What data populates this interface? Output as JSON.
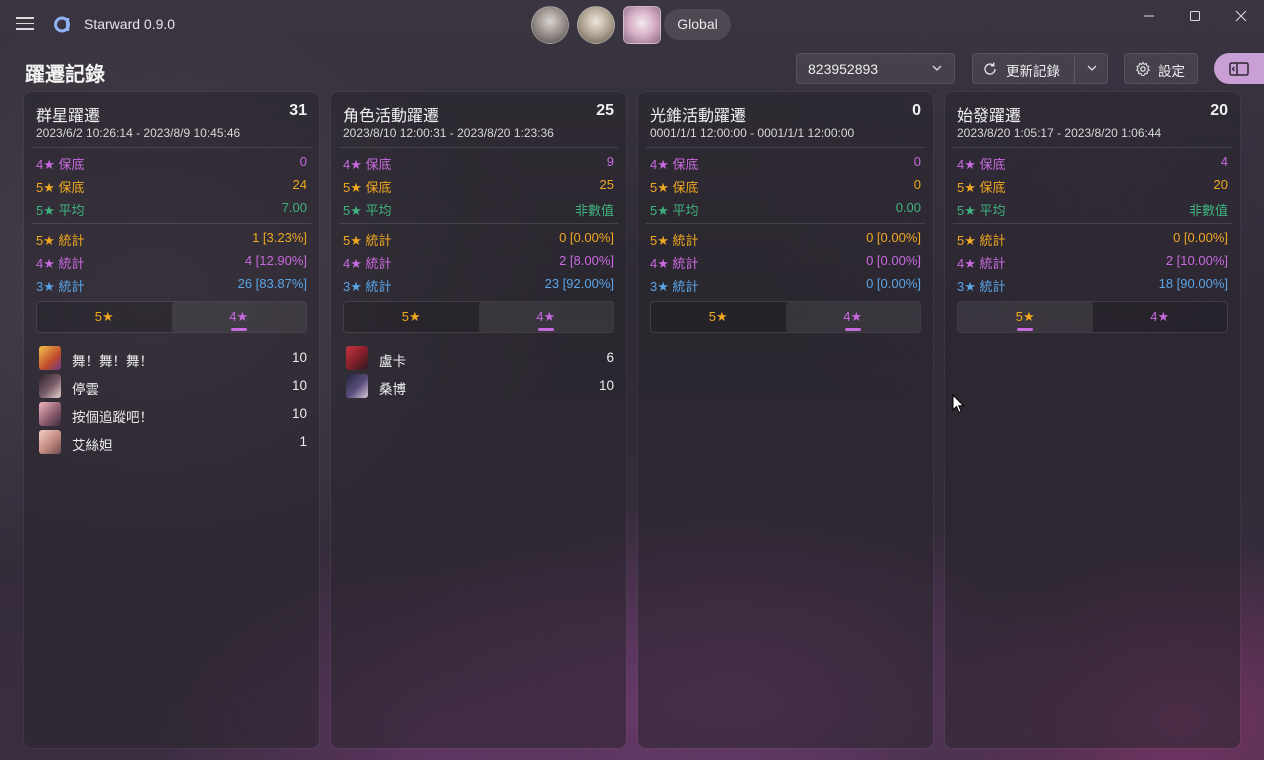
{
  "app": {
    "title": "Starward 0.9.0"
  },
  "server_button": "Global",
  "page_title": "躍遷記錄",
  "uid_select": {
    "value": "823952893"
  },
  "toolbar": {
    "refresh_label": "更新記錄",
    "settings_label": "設定"
  },
  "colors": {
    "four_star": "#c86adf",
    "five_star": "#efa821",
    "average": "#3fb37f",
    "three_star": "#5aa5e8",
    "accent": "#c9a0d6"
  },
  "cards": [
    {
      "title": "群星躍遷",
      "total": "31",
      "range": "2023/6/2 10:26:14 - 2023/8/9 10:45:46",
      "pity": [
        {
          "label": "4★ 保底",
          "value": "0"
        },
        {
          "label": "5★ 保底",
          "value": "24"
        },
        {
          "label": "5★ 平均",
          "value": "7.00"
        }
      ],
      "stats": [
        {
          "label": "5★ 統計",
          "value": "1 [3.23%]"
        },
        {
          "label": "4★ 統計",
          "value": "4 [12.90%]"
        },
        {
          "label": "3★ 統計",
          "value": "26 [83.87%]"
        }
      ],
      "tabs": [
        "5★",
        "4★"
      ],
      "selected_tab": "4★",
      "items": [
        {
          "name": "舞！舞！舞！",
          "count": "10"
        },
        {
          "name": "停雲",
          "count": "10"
        },
        {
          "name": "按個追蹤吧！",
          "count": "10"
        },
        {
          "name": "艾絲妲",
          "count": "1"
        }
      ]
    },
    {
      "title": "角色活動躍遷",
      "total": "25",
      "range": "2023/8/10 12:00:31 - 2023/8/20 1:23:36",
      "pity": [
        {
          "label": "4★ 保底",
          "value": "9"
        },
        {
          "label": "5★ 保底",
          "value": "25"
        },
        {
          "label": "5★ 平均",
          "value": "非數值"
        }
      ],
      "stats": [
        {
          "label": "5★ 統計",
          "value": "0 [0.00%]"
        },
        {
          "label": "4★ 統計",
          "value": "2 [8.00%]"
        },
        {
          "label": "3★ 統計",
          "value": "23 [92.00%]"
        }
      ],
      "tabs": [
        "5★",
        "4★"
      ],
      "selected_tab": "4★",
      "items": [
        {
          "name": "盧卡",
          "count": "6"
        },
        {
          "name": "桑博",
          "count": "10"
        }
      ]
    },
    {
      "title": "光錐活動躍遷",
      "total": "0",
      "range": "0001/1/1 12:00:00 - 0001/1/1 12:00:00",
      "pity": [
        {
          "label": "4★ 保底",
          "value": "0"
        },
        {
          "label": "5★ 保底",
          "value": "0"
        },
        {
          "label": "5★ 平均",
          "value": "0.00"
        }
      ],
      "stats": [
        {
          "label": "5★ 統計",
          "value": "0 [0.00%]"
        },
        {
          "label": "4★ 統計",
          "value": "0 [0.00%]"
        },
        {
          "label": "3★ 統計",
          "value": "0 [0.00%]"
        }
      ],
      "tabs": [
        "5★",
        "4★"
      ],
      "selected_tab": "4★",
      "items": []
    },
    {
      "title": "始發躍遷",
      "total": "20",
      "range": "2023/8/20 1:05:17 - 2023/8/20 1:06:44",
      "pity": [
        {
          "label": "4★ 保底",
          "value": "4"
        },
        {
          "label": "5★ 保底",
          "value": "20"
        },
        {
          "label": "5★ 平均",
          "value": "非數值"
        }
      ],
      "stats": [
        {
          "label": "5★ 統計",
          "value": "0 [0.00%]"
        },
        {
          "label": "4★ 統計",
          "value": "2 [10.00%]"
        },
        {
          "label": "3★ 統計",
          "value": "18 [90.00%]"
        }
      ],
      "tabs": [
        "5★",
        "4★"
      ],
      "selected_tab": "5★",
      "items": []
    }
  ]
}
